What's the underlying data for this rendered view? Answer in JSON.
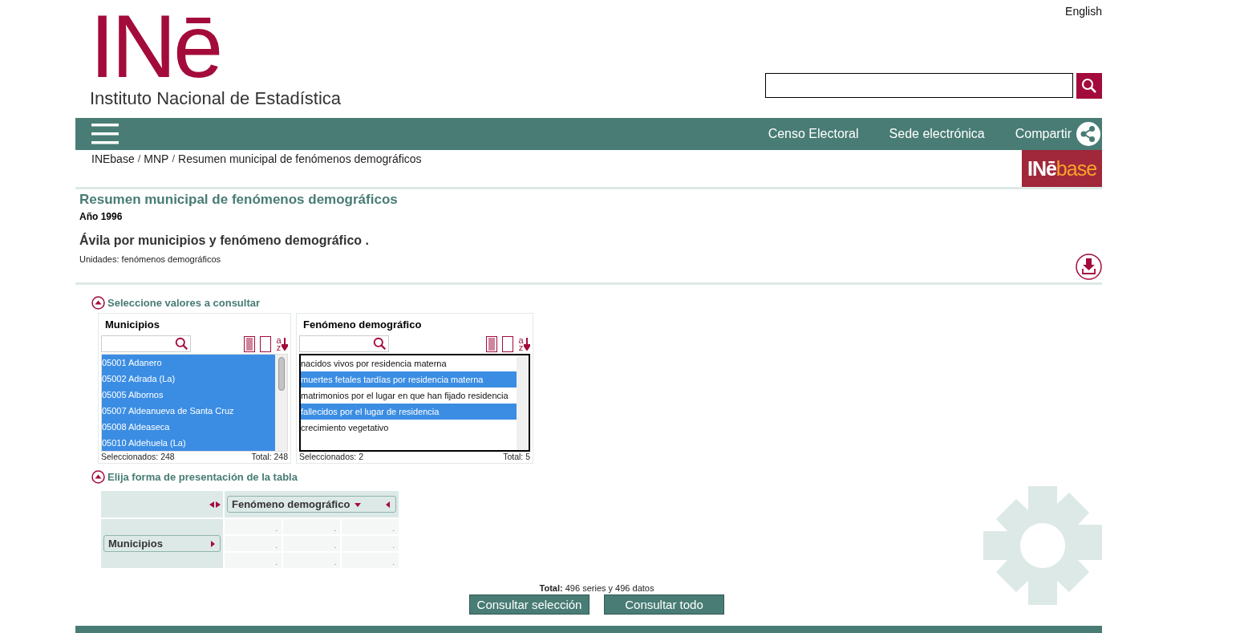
{
  "header": {
    "language_link": "English",
    "logo_mark": "INē",
    "logo_name": "Instituto Nacional de Estadística"
  },
  "nav": {
    "links": [
      "Censo Electoral",
      "Sede electrónica"
    ],
    "share": "Compartir"
  },
  "breadcrumb": {
    "items": [
      "INEbase",
      "MNP",
      "Resumen municipal de fenómenos demográficos"
    ],
    "separator": "/"
  },
  "inebase_logo": {
    "mark": "INē",
    "word": "base"
  },
  "page": {
    "title": "Resumen municipal de fenómenos demográficos",
    "year": "Año 1996",
    "table_title": "Ávila por municipios y fenómeno demográfico .",
    "units": "Unidades: fenómenos demográficos"
  },
  "selection": {
    "heading": "Seleccione valores a consultar",
    "expanded": true,
    "panels": [
      {
        "title": "Municipios",
        "sort_glyphs": "az",
        "focused": false,
        "selected_count": "Seleccionados: 248",
        "total": "Total: 248",
        "items": [
          {
            "label": "05001 Adanero",
            "selected": true
          },
          {
            "label": "05002 Adrada (La)",
            "selected": true
          },
          {
            "label": "05005 Albornos",
            "selected": true
          },
          {
            "label": "05007 Aldeanueva de Santa Cruz",
            "selected": true
          },
          {
            "label": "05008 Aldeaseca",
            "selected": true
          },
          {
            "label": "05010 Aldehuela (La)",
            "selected": true
          }
        ]
      },
      {
        "title": "Fenómeno demográfico",
        "sort_glyphs": "az",
        "focused": true,
        "selected_count": "Seleccionados: 2",
        "total": "Total: 5",
        "items": [
          {
            "label": "nacidos vivos por residencia materna",
            "selected": false
          },
          {
            "label": "muertes fetales tardías por residencia materna",
            "selected": true
          },
          {
            "label": "matrimonios por el lugar en que han fijado residencia",
            "selected": false
          },
          {
            "label": "fallecidos por el lugar de residencia",
            "selected": true
          },
          {
            "label": "crecimiento vegetativo",
            "selected": false
          }
        ]
      }
    ]
  },
  "layout": {
    "heading": "Elija forma de presentación de la tabla",
    "expanded": true,
    "column_variable": "Fenómeno demográfico",
    "row_variable": "Municipios",
    "cells": [
      [
        ".",
        ".",
        "."
      ],
      [
        ".",
        ".",
        "."
      ],
      [
        ".",
        ".",
        "."
      ]
    ]
  },
  "totals": "**Total:** 496 series y  496 datos",
  "buttons": [
    "Consultar selección",
    "Consultar todo"
  ]
}
